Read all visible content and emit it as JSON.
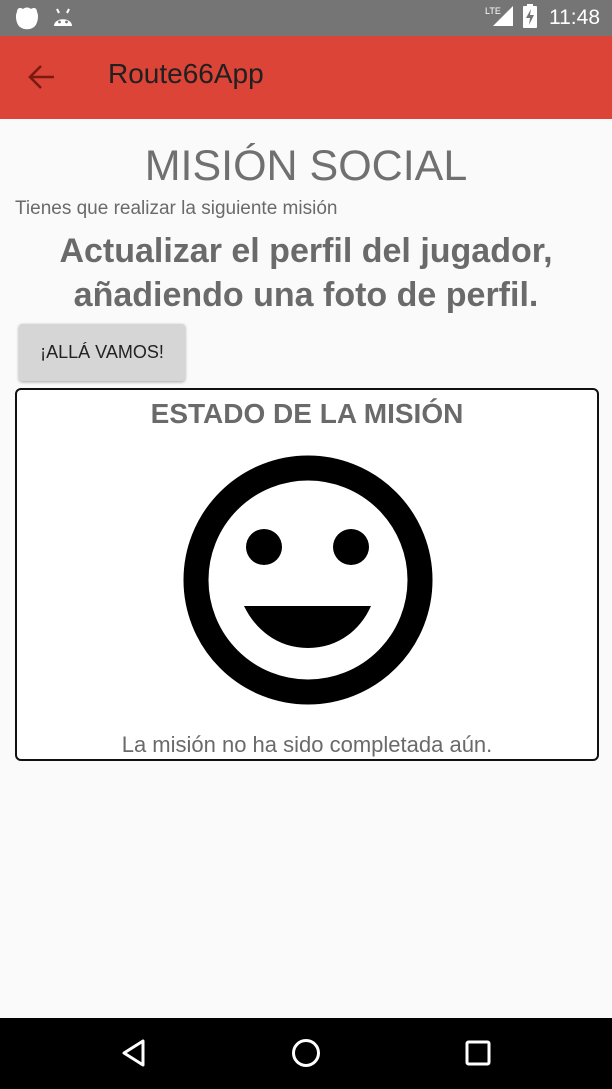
{
  "status_bar": {
    "time": "11:48",
    "network": "LTE",
    "icons": [
      "android-debug-icon",
      "android-icon",
      "signal-icon",
      "battery-charging-icon"
    ]
  },
  "app_bar": {
    "title": "Route66App",
    "back_icon": "arrow-back-icon",
    "background": "#db4437"
  },
  "main": {
    "title": "MISIÓN SOCIAL",
    "intro": "Tienes que realizar la siguiente misión",
    "mission": "Actualizar el perfil del jugador, añadiendo una foto de perfil.",
    "go_button_label": "¡ALLÁ VAMOS!"
  },
  "status_card": {
    "heading": "ESTADO DE LA MISIÓN",
    "icon": "smiley-icon",
    "message": "La misión no ha sido completada aún."
  },
  "nav_bar": {
    "icons": [
      "back-triangle-icon",
      "home-circle-icon",
      "recents-square-icon"
    ]
  }
}
